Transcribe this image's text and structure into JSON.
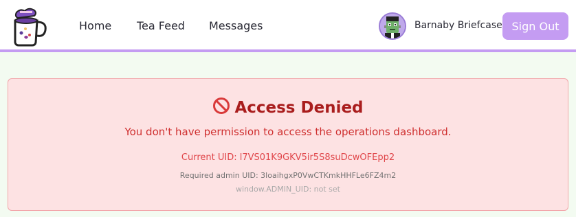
{
  "nav": {
    "logo_icon": "tea-mug-logo-icon",
    "links": [
      "Home",
      "Tea Feed",
      "Messages"
    ]
  },
  "user": {
    "avatar_icon": "frankenstein-avatar-icon",
    "name": "Barnaby Briefcase",
    "signout_label": "Sign Out"
  },
  "error": {
    "icon": "no-entry-icon",
    "title": "Access Denied",
    "message": "You don't have permission to access the operations dashboard.",
    "current_uid": "Current UID: l7VS01K9GKV5ir5S8suDcwOFEpp2",
    "required_uid": "Required admin UID: 3loaihgxP0VwCTKmkHHFLe6FZ4m2",
    "admin_uid": "window.ADMIN_UID: not set"
  },
  "colors": {
    "accent": "#c49cf2",
    "error_bg": "#fde2e3",
    "error_text": "#a91d1d"
  }
}
